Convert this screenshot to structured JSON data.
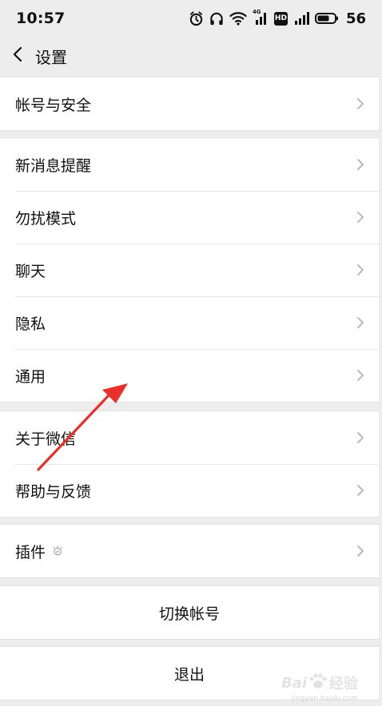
{
  "status_bar": {
    "time": "10:57",
    "network_label": "4G",
    "hd_label": "HD",
    "battery": "56"
  },
  "nav": {
    "title": "设置"
  },
  "groups": {
    "account": {
      "label": "帐号与安全"
    },
    "notifications": {
      "label": "新消息提醒"
    },
    "dnd": {
      "label": "勿扰模式"
    },
    "chat": {
      "label": "聊天"
    },
    "privacy": {
      "label": "隐私"
    },
    "general": {
      "label": "通用"
    },
    "about": {
      "label": "关于微信"
    },
    "help": {
      "label": "帮助与反馈"
    },
    "plugins": {
      "label": "插件"
    }
  },
  "actions": {
    "switch_account": "切换帐号",
    "logout": "退出"
  },
  "watermark": {
    "brand": "Bai",
    "brand_suffix": "经验",
    "url": "jingyan.baidu.com"
  },
  "colors": {
    "background": "#ededed",
    "cell": "#ffffff",
    "annotation_arrow": "#e8302a"
  }
}
